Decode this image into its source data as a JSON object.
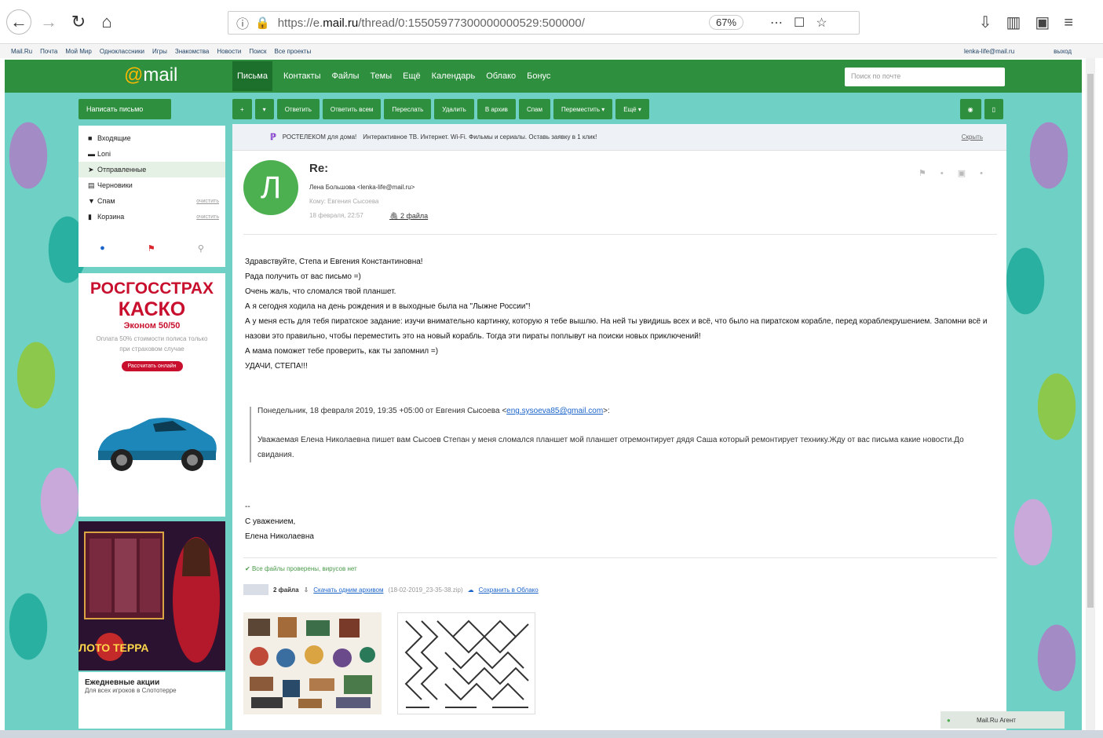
{
  "browser": {
    "url_prefix": "https://e.",
    "url_domain": "mail.ru",
    "url_path": "/thread/0:15505977300000000529:500000/",
    "zoom": "67%"
  },
  "bookmarks": {
    "items": [
      "Mail.Ru",
      "Почта",
      "Мой Мир",
      "Одноклассники",
      "Игры",
      "Знакомства",
      "Новости",
      "Поиск",
      "Все проекты"
    ],
    "account": "lenka-life@mail.ru",
    "exit": "выход"
  },
  "header": {
    "logo_at": "@",
    "logo_text": "mail",
    "nav": [
      "Письма",
      "Контакты",
      "Файлы",
      "Темы",
      "Ещё",
      "Календарь",
      "Облако",
      "Бонус"
    ],
    "search_placeholder": "Поиск по почте"
  },
  "sidebar": {
    "write": "Написать письмо",
    "folders": [
      {
        "icon": "inbox-icon",
        "label": "Входящие",
        "action": ""
      },
      {
        "icon": "folder-icon",
        "label": "Loni",
        "action": ""
      },
      {
        "icon": "sent-icon",
        "label": "Отправленные",
        "action": ""
      },
      {
        "icon": "drafts-icon",
        "label": "Черновики",
        "action": ""
      },
      {
        "icon": "spam-icon",
        "label": "Спам",
        "action": "очистить"
      },
      {
        "icon": "trash-icon",
        "label": "Корзина",
        "action": "очистить"
      }
    ]
  },
  "ad1": {
    "brand": "РОСГОССТРАХ",
    "product": "КАСКО",
    "plan": "Эконом 50/50",
    "desc": "Оплата 50% стоимости полиса только при страховом случае",
    "cta": "Рассчитать онлайн"
  },
  "ad2": {
    "title": "Ежедневные акции",
    "subtitle": "Для всех игроков в Слототерре",
    "logo": "СЛОТО ТЕРРА"
  },
  "toolbar": {
    "buttons": [
      "+",
      "▾",
      "Ответить",
      "Ответить всем",
      "Переслать",
      "Удалить",
      "В архив",
      "Спам",
      "Переместить ▾",
      "Ещё ▾"
    ]
  },
  "promo": {
    "advertiser": "РОСТЕЛЕКОМ для дома!",
    "text": "Интерактивное ТВ. Интернет. Wi-Fi. Фильмы и сериалы. Оставь заявку в 1 клик!",
    "hide": "Скрыть"
  },
  "message": {
    "avatar_letter": "Л",
    "subject": "Re:",
    "from": "Лена Большова <lenka-life@mail.ru>",
    "to": "Кому: Евгения Сысоева",
    "date": "18 февраля, 22:57",
    "files_link": "2 файла",
    "body": [
      "Здравствуйте, Степа и Евгения Константиновна!",
      "Рада получить от вас письмо =)",
      "Очень жаль, что сломался твой планшет.",
      "А я сегодня ходила на день рождения и в выходные была на \"Лыжне России\"!",
      "А у меня есть для тебя пиратское задание: изучи внимательно картинку, которую я тебе вышлю. На ней ты увидишь всех и всё, что было на пиратском корабле, перед кораблекрушением. Запомни всё и назови это правильно, чтобы переместить это на новый корабль. Тогда эти пираты поплывут на поиски новых приключений!",
      "А мама поможет тебе проверить, как ты запомнил =)",
      "УДАЧИ, СТЕПА!!!"
    ],
    "quote_header_pre": "Понедельник, 18 февраля 2019, 19:35 +05:00 от Евгения Сысоева <",
    "quote_email": "eng.sysoeva85@gmail.com",
    "quote_header_post": ">:",
    "quote_body": "Уважаемая Елена Николаевна пишет вам Сысоев Степан у меня сломался планшет мой планшет отремонтирует дядя Саша который ремонтирует технику.Жду от вас письма какие новости.До свидания.",
    "sign": [
      "--",
      "С уважением,",
      "Елена Николаевна"
    ]
  },
  "attachments": {
    "scan": "Все файлы проверены, вирусов нет",
    "count": "2 файла",
    "download": "Скачать одним архивом",
    "archive_name": "(18-02-2019_23-35-38.zip)",
    "save_cloud": "Сохранить в Облако"
  },
  "agent": {
    "label": "Mail.Ru Агент"
  },
  "colors": {
    "brand_green": "#2e8f3e",
    "background": "#6fd1c6"
  }
}
